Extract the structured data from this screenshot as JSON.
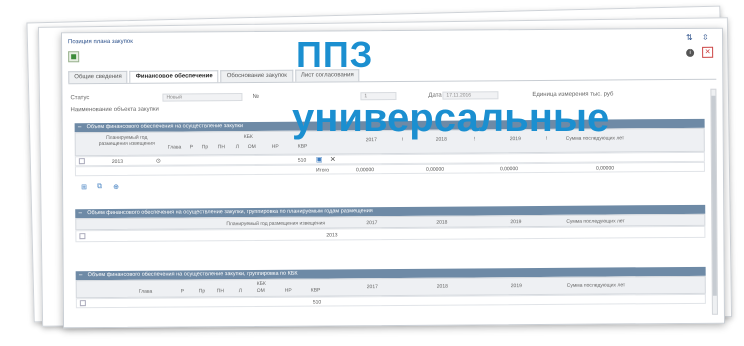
{
  "window": {
    "title": "Позиция плана закупок",
    "ctrl_restore": "⇅",
    "ctrl_resize": "⇳"
  },
  "tabs": [
    {
      "label": "Общие сведения"
    },
    {
      "label": "Финансовое обеспечение"
    },
    {
      "label": "Обоснование закупок"
    },
    {
      "label": "Лист согласования"
    }
  ],
  "form": {
    "status_label": "Статус",
    "status_value": "Новый",
    "number_label": "№",
    "number_value": "1",
    "date_label": "Дата",
    "date_value": "17.11.2016",
    "unit_label": "Единица измерения тыс. руб",
    "object_label": "Наименование объекта закупки"
  },
  "section1": {
    "title": "Объем финансового обеспечения на осуществление закупки",
    "headers": {
      "planned_year": "Планируемый год размещения извещения",
      "kbk": "КБК",
      "glava": "Глава",
      "r": "Р",
      "pr": "Пр",
      "pn": "ПН",
      "l": "Л",
      "om": "ОМ",
      "nr": "НР",
      "kvr": "КВР",
      "y2017": "2017",
      "y2018": "2018",
      "y2019": "2019",
      "sep": "!",
      "later": "Сумма последующих лет"
    },
    "row": {
      "year": "2013",
      "kvr": "510"
    },
    "total": {
      "label": "Итого",
      "v2017": "0,00000",
      "v2018": "0,00000",
      "v2019": "0,00000",
      "later": "0,00000"
    }
  },
  "section2": {
    "title": "Объем финансового обеспечения на осуществление закупки, группировка по планируемым годам размещения",
    "headers": {
      "planned_year": "Планируемый год размещения извещения",
      "y2017": "2017",
      "y2018": "2018",
      "y2019": "2019",
      "later": "Сумма последующих лет"
    },
    "row": {
      "year": "2013"
    }
  },
  "section3": {
    "title": "Объем финансового обеспечения на осуществление закупки, группировка по КБК",
    "headers": {
      "glava": "Глава",
      "r": "Р",
      "pr": "Пр",
      "pn": "ПН",
      "l": "Л",
      "om": "ОМ",
      "nr": "НР",
      "kvr": "КВР",
      "kbk": "КБК",
      "y2017": "2017",
      "y2018": "2018",
      "y2019": "2019",
      "later": "Сумма последующих лет"
    },
    "row": {
      "kvr": "510"
    }
  },
  "overlay": {
    "line1": "ППЗ",
    "line2": "универсальные"
  },
  "colors": {
    "overlay": "#1b8fd0",
    "section_header": "#6e8aa6",
    "title_text": "#2a4f8a"
  }
}
